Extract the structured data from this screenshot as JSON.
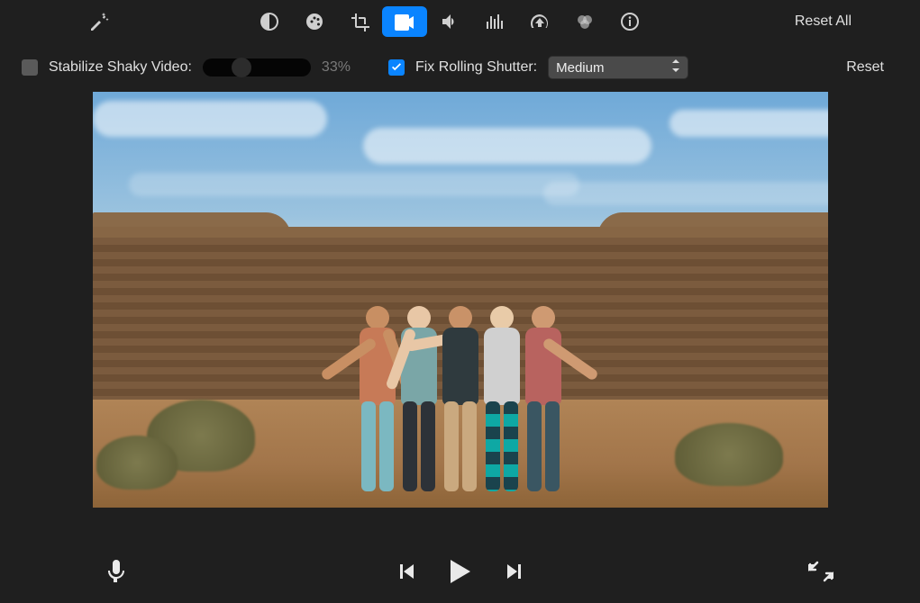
{
  "toolbar": {
    "reset_all_label": "Reset All",
    "tools": [
      {
        "id": "auto-enhance",
        "active": false
      },
      {
        "id": "color-balance",
        "active": false
      },
      {
        "id": "color-correction",
        "active": false
      },
      {
        "id": "crop",
        "active": false
      },
      {
        "id": "stabilization",
        "active": true
      },
      {
        "id": "volume",
        "active": false
      },
      {
        "id": "noise-reduction-eq",
        "active": false
      },
      {
        "id": "speed",
        "active": false
      },
      {
        "id": "filters",
        "active": false
      },
      {
        "id": "info",
        "active": false
      }
    ]
  },
  "controls": {
    "stabilize": {
      "label": "Stabilize Shaky Video:",
      "checked": false,
      "value_pct": "33%"
    },
    "rolling_shutter": {
      "label": "Fix Rolling Shutter:",
      "checked": true,
      "selected": "Medium"
    },
    "reset_label": "Reset"
  },
  "transport": {
    "mic_icon": "microphone-icon",
    "prev_icon": "previous-frame-icon",
    "play_icon": "play-icon",
    "next_icon": "next-frame-icon",
    "fullscreen_icon": "fullscreen-icon"
  }
}
